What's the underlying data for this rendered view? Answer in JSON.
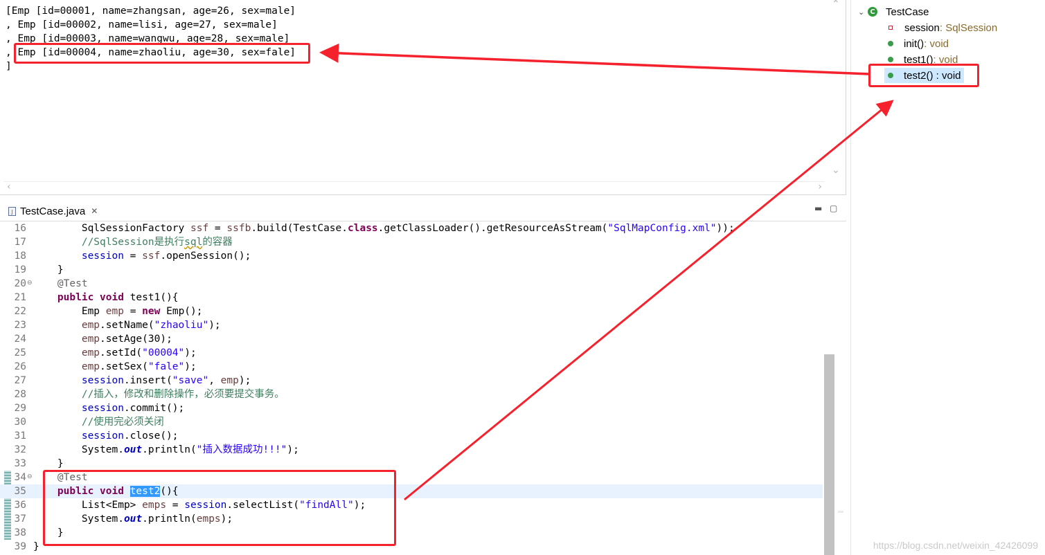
{
  "console": {
    "lines": [
      "[Emp [id=00001, name=zhangsan, age=26, sex=male]",
      ", Emp [id=00002, name=lisi, age=27, sex=male]",
      ", Emp [id=00003, name=wangwu, age=28, sex=male]",
      ", Emp [id=00004, name=zhaoliu, age=30, sex=fale]",
      "]"
    ]
  },
  "outline": {
    "class_name": "TestCase",
    "members": [
      {
        "name": "session",
        "type": " : SqlSession",
        "kind": "field"
      },
      {
        "name": "init()",
        "type": " : void",
        "kind": "method"
      },
      {
        "name": "test1()",
        "type": " : void",
        "kind": "method"
      },
      {
        "name": "test2() : void",
        "type": "",
        "kind": "method",
        "selected": true
      }
    ]
  },
  "editor": {
    "tab_title": "TestCase.java",
    "current_line": 35,
    "lines": [
      {
        "n": "16",
        "tokens": [
          [
            "",
            "        SqlSessionFactory "
          ],
          [
            "loc",
            "ssf"
          ],
          [
            "",
            " = "
          ],
          [
            "loc",
            "ssfb"
          ],
          [
            "",
            ".build(TestCase."
          ],
          [
            "kw",
            "class"
          ],
          [
            "",
            ".getClassLoader().getResourceAsStream("
          ],
          [
            "str",
            "\"SqlMapConfig.xml\""
          ],
          [
            "",
            "));"
          ]
        ]
      },
      {
        "n": "17",
        "tokens": [
          [
            "cmt",
            "        //SqlSession是执行"
          ],
          [
            "cmt squig",
            "sql"
          ],
          [
            "cmt",
            "的容器"
          ]
        ]
      },
      {
        "n": "18",
        "tokens": [
          [
            "",
            "        "
          ],
          [
            "fld",
            "session"
          ],
          [
            "",
            " = "
          ],
          [
            "loc",
            "ssf"
          ],
          [
            "",
            ".openSession();"
          ]
        ]
      },
      {
        "n": "19",
        "tokens": [
          [
            "",
            "    }"
          ]
        ]
      },
      {
        "n": "20",
        "fold": true,
        "tokens": [
          [
            "ann",
            "    @Test"
          ]
        ]
      },
      {
        "n": "21",
        "tokens": [
          [
            "",
            "    "
          ],
          [
            "kw",
            "public"
          ],
          [
            "",
            " "
          ],
          [
            "kw",
            "void"
          ],
          [
            "",
            " test1(){"
          ]
        ]
      },
      {
        "n": "22",
        "tokens": [
          [
            "",
            "        Emp "
          ],
          [
            "loc",
            "emp"
          ],
          [
            "",
            " = "
          ],
          [
            "kw",
            "new"
          ],
          [
            "",
            " Emp();"
          ]
        ]
      },
      {
        "n": "23",
        "tokens": [
          [
            "",
            "        "
          ],
          [
            "loc",
            "emp"
          ],
          [
            "",
            ".setName("
          ],
          [
            "str",
            "\"zhaoliu\""
          ],
          [
            "",
            ");"
          ]
        ]
      },
      {
        "n": "24",
        "tokens": [
          [
            "",
            "        "
          ],
          [
            "loc",
            "emp"
          ],
          [
            "",
            ".setAge(30);"
          ]
        ]
      },
      {
        "n": "25",
        "tokens": [
          [
            "",
            "        "
          ],
          [
            "loc",
            "emp"
          ],
          [
            "",
            ".setId("
          ],
          [
            "str",
            "\"00004\""
          ],
          [
            "",
            ");"
          ]
        ]
      },
      {
        "n": "26",
        "tokens": [
          [
            "",
            "        "
          ],
          [
            "loc",
            "emp"
          ],
          [
            "",
            ".setSex("
          ],
          [
            "str",
            "\"fale\""
          ],
          [
            "",
            ");"
          ]
        ]
      },
      {
        "n": "27",
        "tokens": [
          [
            "",
            "        "
          ],
          [
            "fld",
            "session"
          ],
          [
            "",
            ".insert("
          ],
          [
            "str",
            "\"save\""
          ],
          [
            "",
            ", "
          ],
          [
            "loc",
            "emp"
          ],
          [
            "",
            ");"
          ]
        ]
      },
      {
        "n": "28",
        "tokens": [
          [
            "cmt",
            "        //插入，修改和删除操作，必须要提交事务。"
          ]
        ]
      },
      {
        "n": "29",
        "tokens": [
          [
            "",
            "        "
          ],
          [
            "fld",
            "session"
          ],
          [
            "",
            ".commit();"
          ]
        ]
      },
      {
        "n": "30",
        "tokens": [
          [
            "cmt",
            "        //使用完必须关闭"
          ]
        ]
      },
      {
        "n": "31",
        "tokens": [
          [
            "",
            "        "
          ],
          [
            "fld",
            "session"
          ],
          [
            "",
            ".close();"
          ]
        ]
      },
      {
        "n": "32",
        "tokens": [
          [
            "",
            "        System."
          ],
          [
            "sfld",
            "out"
          ],
          [
            "",
            ".println("
          ],
          [
            "str",
            "\"插入数据成功!!!\""
          ],
          [
            "",
            ");"
          ]
        ]
      },
      {
        "n": "33",
        "tokens": [
          [
            "",
            "    }"
          ]
        ]
      },
      {
        "n": "34",
        "fold": true,
        "tokens": [
          [
            "ann",
            "    @Test"
          ]
        ]
      },
      {
        "n": "35",
        "tokens": [
          [
            "",
            "    "
          ],
          [
            "kw",
            "public"
          ],
          [
            "",
            " "
          ],
          [
            "kw",
            "void"
          ],
          [
            "",
            " "
          ],
          [
            "hl",
            "test2"
          ],
          [
            "",
            "(){"
          ]
        ]
      },
      {
        "n": "36",
        "tokens": [
          [
            "",
            "        List<Emp> "
          ],
          [
            "loc",
            "emps"
          ],
          [
            "",
            " = "
          ],
          [
            "fld",
            "session"
          ],
          [
            "",
            ".selectList("
          ],
          [
            "str",
            "\"findAll\""
          ],
          [
            "",
            ");"
          ]
        ]
      },
      {
        "n": "37",
        "tokens": [
          [
            "",
            "        System."
          ],
          [
            "sfld",
            "out"
          ],
          [
            "",
            ".println("
          ],
          [
            "loc",
            "emps"
          ],
          [
            "",
            ");"
          ]
        ]
      },
      {
        "n": "38",
        "tokens": [
          [
            "",
            "    }"
          ]
        ]
      },
      {
        "n": "39",
        "tokens": [
          [
            "",
            "}"
          ]
        ]
      }
    ]
  },
  "annotation_color": "#f5222d",
  "watermark": "https://blog.csdn.net/weixin_42426099"
}
